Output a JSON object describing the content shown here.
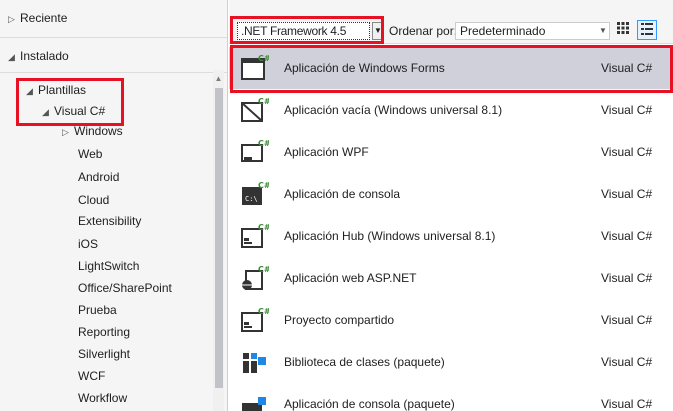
{
  "tree": {
    "recent": "Reciente",
    "installed": "Instalado",
    "templates": "Plantillas",
    "visual_csharp": "Visual C#",
    "items": [
      "Windows",
      "Web",
      "Android",
      "Cloud",
      "Extensibility",
      "iOS",
      "LightSwitch",
      "Office/SharePoint",
      "Prueba",
      "Reporting",
      "Silverlight",
      "WCF",
      "Workflow"
    ]
  },
  "toolbar": {
    "framework": ".NET Framework 4.5",
    "sort_label": "Ordenar por:",
    "sort_value": "Predeterminado"
  },
  "templates": [
    {
      "name": "Aplicación de Windows Forms",
      "lang": "Visual C#",
      "icon": "winforms-icon"
    },
    {
      "name": "Aplicación vacía (Windows universal 8.1)",
      "lang": "Visual C#",
      "icon": "blank-app-icon"
    },
    {
      "name": "Aplicación WPF",
      "lang": "Visual C#",
      "icon": "wpf-icon"
    },
    {
      "name": "Aplicación de consola",
      "lang": "Visual C#",
      "icon": "console-icon"
    },
    {
      "name": "Aplicación Hub (Windows universal 8.1)",
      "lang": "Visual C#",
      "icon": "hub-app-icon"
    },
    {
      "name": "Aplicación web ASP.NET",
      "lang": "Visual C#",
      "icon": "aspnet-icon"
    },
    {
      "name": "Proyecto compartido",
      "lang": "Visual C#",
      "icon": "shared-project-icon"
    },
    {
      "name": "Biblioteca de clases (paquete)",
      "lang": "Visual C#",
      "icon": "class-library-package-icon"
    },
    {
      "name": "Aplicación de consola (paquete)",
      "lang": "Visual C#",
      "icon": "console-package-icon"
    }
  ],
  "colors": {
    "highlight_red": "#e81123",
    "selected_row": "#cfd0da",
    "csharp_green": "#388a34",
    "package_blue": "#1e88e5"
  }
}
